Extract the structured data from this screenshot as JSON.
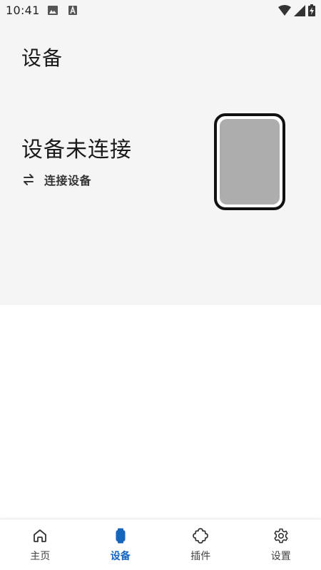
{
  "status_bar": {
    "time": "10:41",
    "icons": [
      "image-icon",
      "a-badge-icon",
      "wifi-icon",
      "signal-icon",
      "battery-charging-icon"
    ]
  },
  "page": {
    "title": "设备"
  },
  "device": {
    "status_text": "设备未连接",
    "connect_label": "连接设备",
    "connect_icon": "swap-arrows-icon",
    "image": "watch-icon"
  },
  "bottom_nav": {
    "active_color": "#1565c0",
    "items": [
      {
        "label": "主页",
        "icon": "home-icon",
        "active": false
      },
      {
        "label": "设备",
        "icon": "watch-icon",
        "active": true
      },
      {
        "label": "插件",
        "icon": "puzzle-icon",
        "active": false
      },
      {
        "label": "设置",
        "icon": "gear-icon",
        "active": false
      }
    ]
  }
}
